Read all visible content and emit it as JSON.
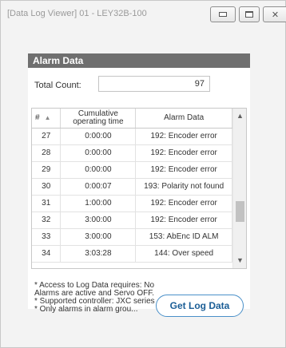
{
  "window": {
    "title": "[Data Log Viewer] 01 - LEY32B-100"
  },
  "panel": {
    "header": "Alarm Data",
    "total_count_label": "Total Count:",
    "total_count_value": "97"
  },
  "table": {
    "columns": [
      "#",
      "Cumulative operating time",
      "Alarm Data"
    ],
    "rows": [
      {
        "num": "27",
        "time": "0:00:00",
        "alarm": "192: Encoder error"
      },
      {
        "num": "28",
        "time": "0:00:00",
        "alarm": "192: Encoder error"
      },
      {
        "num": "29",
        "time": "0:00:00",
        "alarm": "192: Encoder error"
      },
      {
        "num": "30",
        "time": "0:00:07",
        "alarm": "193: Polarity not found"
      },
      {
        "num": "31",
        "time": "1:00:00",
        "alarm": "192: Encoder error"
      },
      {
        "num": "32",
        "time": "3:00:00",
        "alarm": "192: Encoder error"
      },
      {
        "num": "33",
        "time": "3:00:00",
        "alarm": "153: AbEnc ID ALM"
      },
      {
        "num": "34",
        "time": "3:03:28",
        "alarm": "144: Over speed"
      }
    ]
  },
  "note": "* Access to Log Data requires: No Alarms are active and Servo OFF.\n* Supported controller: JXC series\n* Only alarms in alarm grou...",
  "actions": {
    "get_log_label": "Get Log Data"
  }
}
